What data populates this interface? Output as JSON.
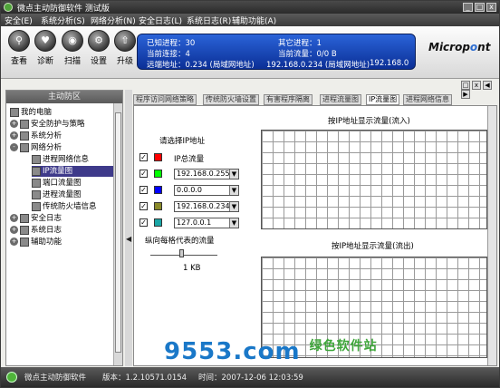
{
  "app": {
    "title": "微点主动防御软件  测试版"
  },
  "window_controls": [
    "_",
    "□",
    "x"
  ],
  "menu": [
    "安全(E)",
    "系统分析(S)",
    "网络分析(N)",
    "安全日志(L)",
    "系统日志(R)",
    "辅助功能(A)"
  ],
  "toolbar": [
    "查看",
    "诊断",
    "扫描",
    "设置",
    "升级"
  ],
  "status": {
    "proc_label": "已知进程：30",
    "other_label": "其它进程：1",
    "conn_label": "当前连接：4",
    "flow_label": "当前流量：0/0 B",
    "remote_label": "远端地址：0.234 (局域网地址)",
    "remote_ip": "192.168.0.234 (局域网地址)",
    "local_ip": "192.168.0"
  },
  "logo": {
    "text1": "Microp",
    "text2": "o",
    "text3": "nt"
  },
  "left": {
    "header": "主动防区",
    "tree": [
      "我的电脑",
      "安全防护与策略",
      "系统分析",
      "网络分析",
      "进程网络信息",
      "IP流量图",
      "端口流量图",
      "进程流量图",
      "传统防火墙信息",
      "安全日志",
      "系统日志",
      "辅助功能"
    ]
  },
  "tabs": [
    "程序访问网络策略",
    "传统防火墙设置",
    "有害程序隔离",
    "进程流量图",
    "IP流量图",
    "进程网络信息"
  ],
  "content": {
    "select_ip": "请选择IP地址",
    "total": "IP总流量",
    "ips": [
      "192.168.0.255",
      "0.0.0.0",
      "192.168.0.234",
      "127.0.0.1"
    ],
    "scale_label": "纵向每格代表的流量",
    "scale_value": "1 KB",
    "chart_in": "按IP地址显示流量(流入)",
    "chart_out": "按IP地址显示流量(流出)"
  },
  "colors": {
    "c1": "#ff0000",
    "c2": "#00ff00",
    "c3": "#0000ff",
    "c4": "#8a8a2a",
    "c5": "#1aa6a6"
  },
  "statusbar": {
    "app": "微点主动防御软件",
    "version": "版本：1.2.10571.0154",
    "time": "时间：2007-12-06 12:03:59"
  },
  "watermark": {
    "main": "9553.com",
    "sub": "绿色软件站"
  }
}
